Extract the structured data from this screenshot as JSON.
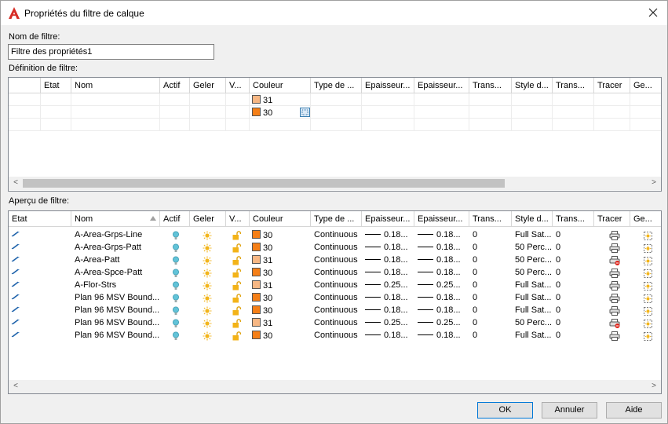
{
  "window": {
    "title": "Propriétés du filtre de calque"
  },
  "filter_name": {
    "label": "Nom de filtre:",
    "value": "Filtre des propriétés1"
  },
  "definition": {
    "label": "Définition de filtre:",
    "columns": [
      "",
      "Etat",
      "Nom",
      "Actif",
      "Geler",
      "V...",
      "Couleur",
      "Type de ...",
      "Epaisseur...",
      "Epaisseur...",
      "Trans...",
      "Style d...",
      "Trans...",
      "Tracer",
      "Ge..."
    ],
    "rows": [
      {
        "color_value": "31",
        "color_hex": "#f7b784"
      },
      {
        "color_value": "30",
        "color_hex": "#f57f17",
        "has_edit_button": true
      }
    ]
  },
  "preview": {
    "label": "Aperçu de filtre:",
    "columns": [
      "Etat",
      "Nom",
      "Actif",
      "Geler",
      "V...",
      "Couleur",
      "Type de ...",
      "Epaisseur...",
      "Epaisseur...",
      "Trans...",
      "Style d...",
      "Trans...",
      "Tracer",
      "Ge..."
    ],
    "rows": [
      {
        "name": "A-Area-Grps-Line",
        "color": "30",
        "color_hex": "#f57f17",
        "linetype": "Continuous",
        "lw1": "0.18...",
        "lw2": "0.18...",
        "trans": "0",
        "style": "Full Sat...",
        "trans2": "0",
        "plot_off": false
      },
      {
        "name": "A-Area-Grps-Patt",
        "color": "30",
        "color_hex": "#f57f17",
        "linetype": "Continuous",
        "lw1": "0.18...",
        "lw2": "0.18...",
        "trans": "0",
        "style": "50 Perc...",
        "trans2": "0",
        "plot_off": false
      },
      {
        "name": "A-Area-Patt",
        "color": "31",
        "color_hex": "#f7b784",
        "linetype": "Continuous",
        "lw1": "0.18...",
        "lw2": "0.18...",
        "trans": "0",
        "style": "50 Perc...",
        "trans2": "0",
        "plot_off": true
      },
      {
        "name": "A-Area-Spce-Patt",
        "color": "30",
        "color_hex": "#f57f17",
        "linetype": "Continuous",
        "lw1": "0.18...",
        "lw2": "0.18...",
        "trans": "0",
        "style": "50 Perc...",
        "trans2": "0",
        "plot_off": false
      },
      {
        "name": "A-Flor-Strs",
        "color": "31",
        "color_hex": "#f7b784",
        "linetype": "Continuous",
        "lw1": "0.25...",
        "lw2": "0.25...",
        "trans": "0",
        "style": "Full Sat...",
        "trans2": "0",
        "plot_off": false
      },
      {
        "name": "Plan 96 MSV Bound...",
        "color": "30",
        "color_hex": "#f57f17",
        "linetype": "Continuous",
        "lw1": "0.18...",
        "lw2": "0.18...",
        "trans": "0",
        "style": "Full Sat...",
        "trans2": "0",
        "plot_off": false
      },
      {
        "name": "Plan 96 MSV Bound...",
        "color": "30",
        "color_hex": "#f57f17",
        "linetype": "Continuous",
        "lw1": "0.18...",
        "lw2": "0.18...",
        "trans": "0",
        "style": "Full Sat...",
        "trans2": "0",
        "plot_off": false
      },
      {
        "name": "Plan 96 MSV Bound...",
        "color": "31",
        "color_hex": "#f7b784",
        "linetype": "Continuous",
        "lw1": "0.25...",
        "lw2": "0.25...",
        "trans": "0",
        "style": "50 Perc...",
        "trans2": "0",
        "plot_off": true
      },
      {
        "name": "Plan 96 MSV Bound...",
        "color": "30",
        "color_hex": "#f57f17",
        "linetype": "Continuous",
        "lw1": "0.18...",
        "lw2": "0.18...",
        "trans": "0",
        "style": "Full Sat...",
        "trans2": "0",
        "plot_off": false
      }
    ]
  },
  "buttons": {
    "ok": "OK",
    "cancel": "Annuler",
    "help": "Aide"
  },
  "icons": {
    "app": "autocad-logo-icon",
    "close": "close-icon",
    "status": "layer-status-icon",
    "on": "lightbulb-icon",
    "freeze": "sun-icon",
    "lock": "unlock-icon",
    "plot": "printer-icon",
    "newvp": "new-viewport-freeze-icon"
  }
}
